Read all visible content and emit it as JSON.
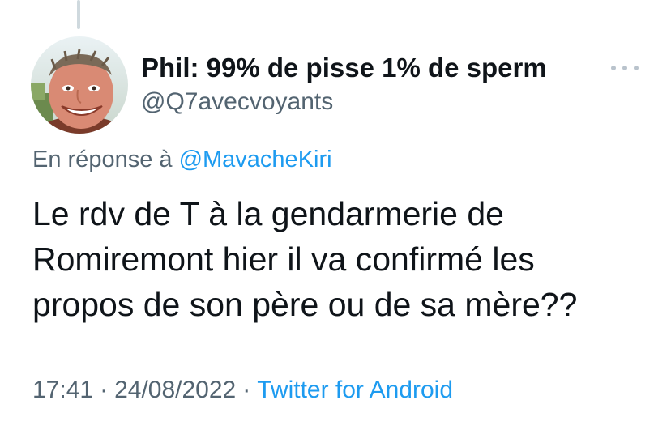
{
  "author": {
    "display_name": "Phil: 99% de pisse 1% de sperm",
    "handle": "@Q7avecvoyants"
  },
  "reply_context": {
    "prefix": "En réponse à",
    "mention": "@MavacheKiri"
  },
  "tweet": {
    "text_lines": [
      "Le rdv de T à la gendarmerie de",
      "Romiremont hier il va confirmé les",
      "propos de son père ou de sa mère??"
    ]
  },
  "meta": {
    "time": "17:41",
    "date": "24/08/2022",
    "separator": "·",
    "source": "Twitter for Android"
  },
  "colors": {
    "link": "#1d9bf0",
    "secondary_text": "#536471",
    "primary_text": "#0f1419"
  },
  "icons": {
    "more": "more-horizontal-icon",
    "avatar": "user-avatar"
  }
}
